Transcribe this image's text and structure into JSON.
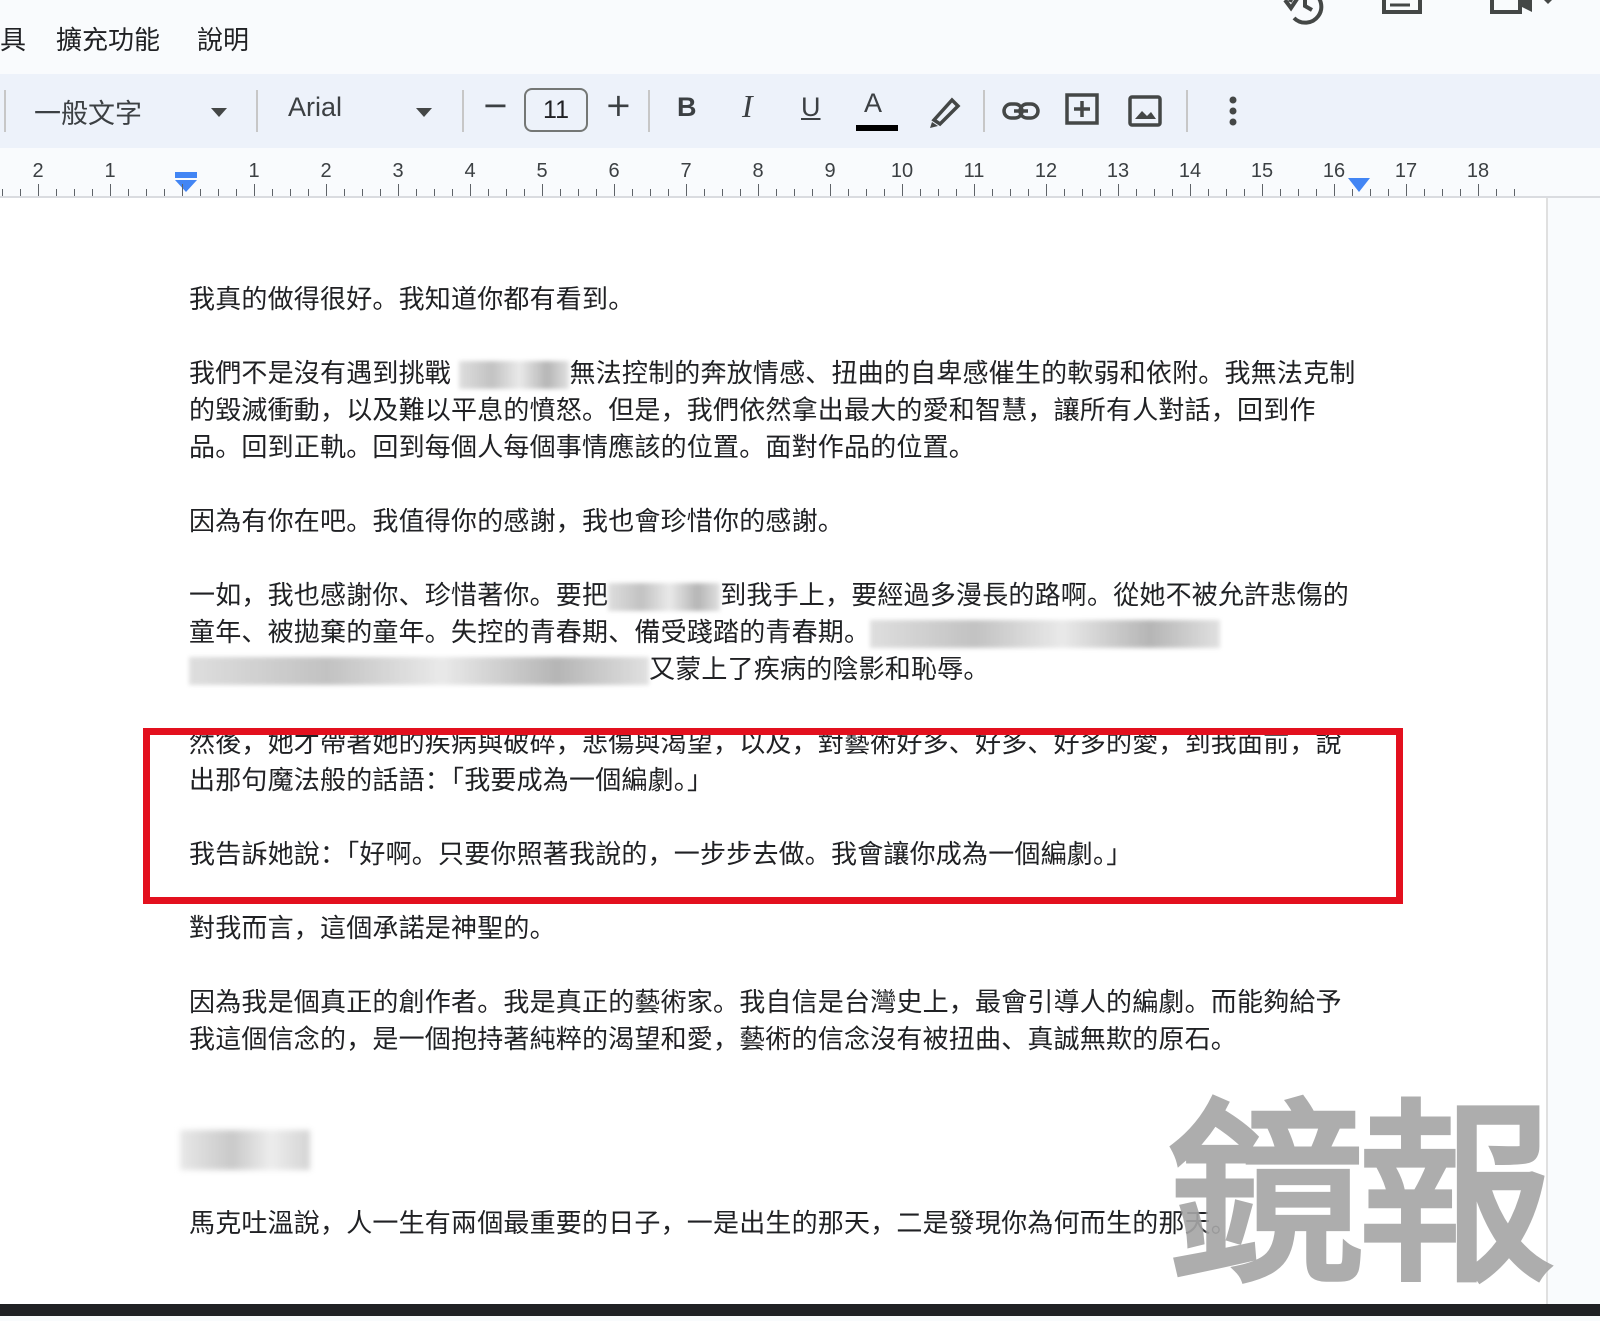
{
  "menubar": {
    "items": [
      "具",
      "擴充功能",
      "說明"
    ]
  },
  "toolbar": {
    "style_label": "一般文字",
    "font_label": "Arial",
    "font_size": "11",
    "decrease_label": "−",
    "increase_label": "+",
    "bold_label": "B",
    "italic_label": "I",
    "underline_label": "U",
    "text_color_label": "A"
  },
  "ruler": {
    "numbers": [
      "2",
      "1",
      "1",
      "2",
      "3",
      "4",
      "5",
      "6",
      "7",
      "8",
      "9",
      "10",
      "11",
      "12",
      "13",
      "14",
      "15",
      "16",
      "17",
      "18"
    ]
  },
  "document": {
    "p1": "我真的做得很好。我知道你都有看到。",
    "p2a": "我們不是沒有遇到挑戰 ",
    "p2b": "無法控制的奔放情感、扭曲的自卑感催生的軟弱和依附。我無法克制的毀滅衝動，以及難以平息的憤怒。但是，我們依然拿出最大的愛和智慧，讓所有人對話，回到作品。回到正軌。回到每個人每個事情應該的位置。面對作品的位置。",
    "p3": "因為有你在吧。我值得你的感謝，我也會珍惜你的感謝。",
    "p4a": "一如，我也感謝你、珍惜著你。要把",
    "p4b": "到我手上，要經過多漫長的路啊。從她不被允許悲傷的童年、被拋棄的童年。失控的青春期、備受踐踏的青春期。",
    "p4c": "又蒙上了疾病的陰影和恥辱。",
    "p5": "然後，她才帶著她的疾病與破碎，悲傷與渴望，以及，對藝術好多、好多、好多的愛，到我面前，說出那句魔法般的話語：「我要成為一個編劇。」",
    "p6": "我告訴她說：「好啊。只要你照著我說的，一步步去做。我會讓你成為一個編劇。」",
    "p7": "對我而言，這個承諾是神聖的。",
    "p8": "因為我是個真正的創作者。我是真正的藝術家。我自信是台灣史上，最會引導人的編劇。而能夠給予我這個信念的，是一個抱持著純粹的渴望和愛，藝術的信念沒有被扭曲、真誠無欺的原石。",
    "p9": "馬克吐溫說，人一生有兩個最重要的日子，一是出生的那天，二是發現你為何而生的那天。"
  },
  "watermark": "鏡報",
  "colors": {
    "highlight_border": "#e3101e",
    "toolbar_bg": "#edf2fa",
    "ruler_marker": "#4285f4"
  }
}
